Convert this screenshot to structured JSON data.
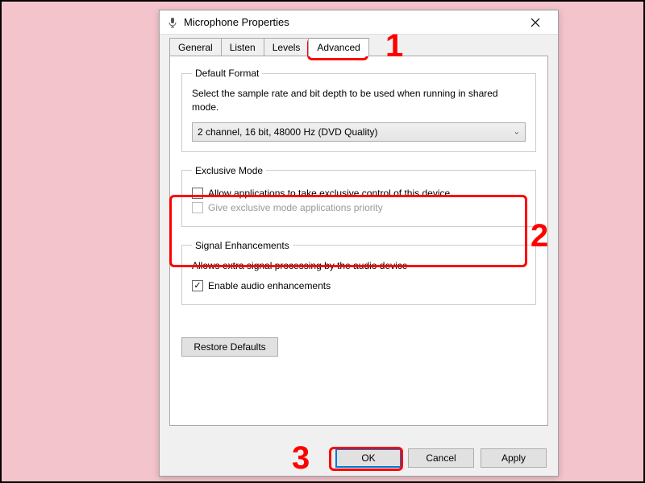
{
  "window": {
    "title": "Microphone Properties"
  },
  "tabs": {
    "general": "General",
    "listen": "Listen",
    "levels": "Levels",
    "advanced": "Advanced"
  },
  "default_format": {
    "legend": "Default Format",
    "desc": "Select the sample rate and bit depth to be used when running in shared mode.",
    "selected": "2 channel, 16 bit, 48000 Hz (DVD Quality)"
  },
  "exclusive_mode": {
    "legend": "Exclusive Mode",
    "allow_label": "Allow applications to take exclusive control of this device",
    "priority_label": "Give exclusive mode applications priority"
  },
  "signal_enhancements": {
    "legend": "Signal Enhancements",
    "desc": "Allows extra signal processing by the audio device",
    "enable_label": "Enable audio enhancements"
  },
  "buttons": {
    "restore": "Restore Defaults",
    "ok": "OK",
    "cancel": "Cancel",
    "apply": "Apply"
  },
  "annotations": {
    "n1": "1",
    "n2": "2",
    "n3": "3"
  }
}
